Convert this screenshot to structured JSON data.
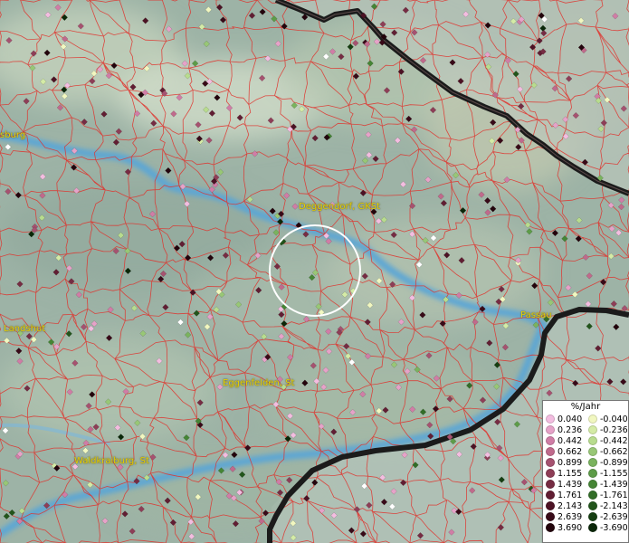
{
  "map": {
    "places": [
      {
        "id": "burg",
        "label": "sburg"
      },
      {
        "id": "deggendorf",
        "label": "Deggendorf, GKSt"
      },
      {
        "id": "passau",
        "label": "Passau"
      },
      {
        "id": "landshut",
        "label": "Landshut"
      },
      {
        "id": "eggenfelden",
        "label": "Eggenfelden, St"
      },
      {
        "id": "waldkraiburg",
        "label": "Waldkraiburg, St"
      }
    ],
    "colors": {
      "river": "#5aa6d6",
      "terrain": "#9fb3a8",
      "municipality_border": "#e0302a",
      "national_border": "#1b1b1b",
      "selection_circle": "#ffffff"
    }
  },
  "legend": {
    "title": "%/Jahr",
    "positive": [
      {
        "value": "0.040",
        "color": "#f3bde0"
      },
      {
        "value": "0.236",
        "color": "#e6a2c8"
      },
      {
        "value": "0.442",
        "color": "#d07da6"
      },
      {
        "value": "0.662",
        "color": "#c06a8c"
      },
      {
        "value": "0.899",
        "color": "#a65270"
      },
      {
        "value": "1.155",
        "color": "#8e3e57"
      },
      {
        "value": "1.439",
        "color": "#762c43"
      },
      {
        "value": "1.761",
        "color": "#611e33"
      },
      {
        "value": "2.143",
        "color": "#4c1224"
      },
      {
        "value": "2.639",
        "color": "#380a18"
      },
      {
        "value": "3.690",
        "color": "#23040c"
      }
    ],
    "negative": [
      {
        "value": "-0.040",
        "color": "#f1f7c0"
      },
      {
        "value": "-0.236",
        "color": "#d4eba6"
      },
      {
        "value": "-0.442",
        "color": "#b8dc8e"
      },
      {
        "value": "-0.662",
        "color": "#98c776"
      },
      {
        "value": "-0.899",
        "color": "#7ab35e"
      },
      {
        "value": "-1.155",
        "color": "#5d9c48"
      },
      {
        "value": "-1.439",
        "color": "#458535"
      },
      {
        "value": "-1.761",
        "color": "#326d27"
      },
      {
        "value": "-2.143",
        "color": "#22551b"
      },
      {
        "value": "-2.639",
        "color": "#153e11"
      },
      {
        "value": "-3.690",
        "color": "#0a2708"
      }
    ]
  }
}
